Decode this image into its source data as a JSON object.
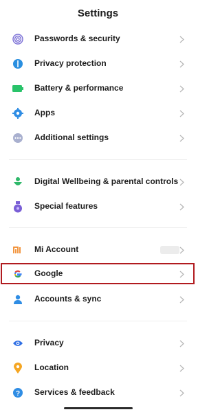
{
  "header": {
    "title": "Settings"
  },
  "groups": [
    {
      "items": [
        {
          "label": "Passwords & security",
          "icon": "fingerprint-icon",
          "color": "#7a6fd6"
        },
        {
          "label": "Privacy protection",
          "icon": "privacy-shield-icon",
          "color": "#2a8fe0"
        },
        {
          "label": "Battery & performance",
          "icon": "battery-icon",
          "color": "#29c36a"
        },
        {
          "label": "Apps",
          "icon": "gear-icon",
          "color": "#2f8de4"
        },
        {
          "label": "Additional settings",
          "icon": "more-dots-icon",
          "color": "#8a93b8"
        }
      ]
    },
    {
      "items": [
        {
          "label": "Digital Wellbeing & parental controls",
          "icon": "wellbeing-icon",
          "color": "#2fb86a"
        },
        {
          "label": "Special features",
          "icon": "special-features-icon",
          "color": "#7a5fd6"
        }
      ]
    },
    {
      "items": [
        {
          "label": "Mi Account",
          "icon": "mi-logo-icon",
          "color": "#f08a2c"
        },
        {
          "label": "Google",
          "icon": "google-g-icon",
          "color": "#4285f4",
          "highlighted": true
        },
        {
          "label": "Accounts & sync",
          "icon": "person-icon",
          "color": "#2f8de4"
        }
      ]
    },
    {
      "items": [
        {
          "label": "Privacy",
          "icon": "eye-icon",
          "color": "#2f6fe4"
        },
        {
          "label": "Location",
          "icon": "location-pin-icon",
          "color": "#f5a623"
        },
        {
          "label": "Services & feedback",
          "icon": "help-icon",
          "color": "#2f8de4"
        }
      ]
    }
  ],
  "highlight_color": "#b11b1f"
}
